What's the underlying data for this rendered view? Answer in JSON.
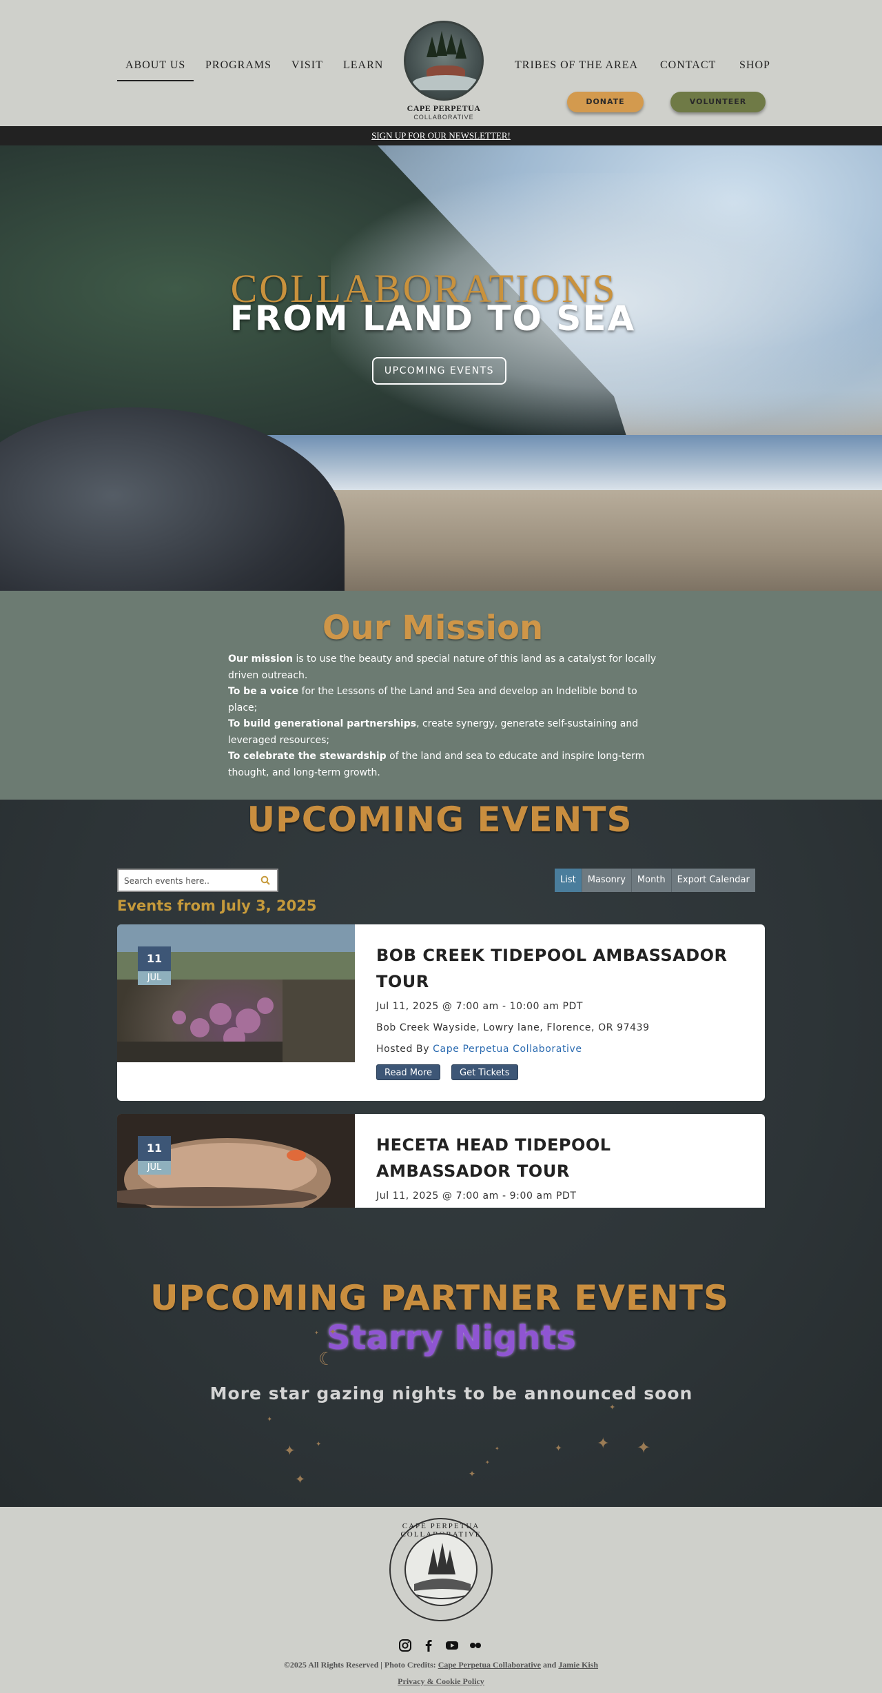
{
  "nav": {
    "left": [
      "ABOUT US",
      "PROGRAMS",
      "VISIT",
      "LEARN"
    ],
    "right": [
      "TRIBES OF THE AREA",
      "CONTACT",
      "SHOP"
    ]
  },
  "logo": {
    "line1": "CAPE PERPETUA",
    "line2": "COLLABORATIVE"
  },
  "buttons": {
    "donate": "DONATE",
    "volunteer": "VOLUNTEER"
  },
  "newsletter": "SIGN UP FOR OUR NEWSLETTER!",
  "hero": {
    "title1": "COLLABORATIONS",
    "title2": "FROM LAND TO SEA",
    "cta": "UPCOMING EVENTS"
  },
  "mission": {
    "title": "Our Mission",
    "p1_bold": "Our mission",
    "p1": " is to use the beauty and special nature of this land as a catalyst for locally driven outreach.",
    "p2_bold": "To be a voice",
    "p2": " for the Lessons of the Land and Sea and develop an Indelible bond to place;",
    "p3_bold": "To build generational partnerships",
    "p3": ", create synergy,  generate self-sustaining and leveraged resources;",
    "p4_bold": "To celebrate the stewardship",
    "p4": " of the land and sea to educate and inspire long-term thought, and long-term growth."
  },
  "events": {
    "title": "UPCOMING EVENTS",
    "search_placeholder": "Search events here..",
    "views": [
      "List",
      "Masonry",
      "Month",
      "Export Calendar"
    ],
    "from_label": "Events from July 3, 2025",
    "items": [
      {
        "day": "11",
        "month": "JUL",
        "title": "BOB CREEK TIDEPOOL AMBASSADOR TOUR",
        "time": "Jul 11, 2025 @ 7:00 am - 10:00 am PDT",
        "location": "Bob Creek Wayside, Lowry lane, Florence, OR 97439",
        "hosted_prefix": "Hosted By ",
        "host": "Cape Perpetua Collaborative",
        "read_more": "Read More",
        "tickets": "Get Tickets"
      },
      {
        "day": "11",
        "month": "JUL",
        "title": "HECETA HEAD TIDEPOOL AMBASSADOR TOUR",
        "time": "Jul 11, 2025 @ 7:00 am - 9:00 am PDT"
      }
    ]
  },
  "partner": {
    "title": "UPCOMING PARTNER EVENTS",
    "subtitle": "Starry Nights",
    "note": "More star gazing nights to be announced soon"
  },
  "footer": {
    "ring_text": "CAPE PERPETUA COLLABORATIVE",
    "social_icons": [
      "instagram-icon",
      "facebook-icon",
      "youtube-icon",
      "flickr-icon"
    ],
    "copyright_prefix": "©2025 All Rights Reserved | Photo Credits: ",
    "credit1": "Cape Perpetua Collaborative",
    "and": " and ",
    "credit2": "Jamie Kish",
    "privacy": "Privacy & Cookie Policy"
  },
  "colors": {
    "header_bg": "#cfd0cb",
    "gold": "#c98e3f",
    "mission_bg": "#6c7b72",
    "dark_bg": "#2e3538",
    "donate": "#d39a4e",
    "volunteer": "#6f7a46",
    "accent_blue": "#3d5676",
    "purple": "#8f55d2"
  }
}
